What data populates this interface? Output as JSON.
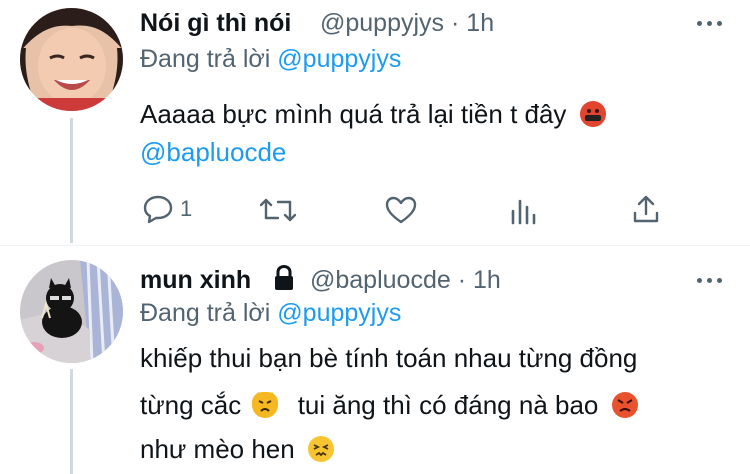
{
  "tweet1": {
    "display_name": "Nói gì thì nói",
    "handle": "@puppyjys",
    "separator": "·",
    "time": "1h",
    "replying_label": "Đang trả lời",
    "replying_to": "@puppyjys",
    "text_line1": "Aaaaa bực mình quá trả lại tiền t đây",
    "mention": "@bapluocde",
    "reply_count": "1"
  },
  "tweet2": {
    "display_name": "mun xinh",
    "handle": "@bapluocde",
    "separator": "·",
    "time": "1h",
    "replying_label": "Đang trả lời",
    "replying_to": "@puppyjys",
    "text_line1": "khiếp thui bạn bè tính toán nhau từng đồng",
    "text_line2_a": "từng cắc",
    "text_line2_b": "tui ăng thì có đáng nà bao",
    "text_line3": "như mèo hen"
  },
  "icons": {
    "more": "more-horizontal-icon",
    "reply": "reply-icon",
    "retweet": "retweet-icon",
    "like": "heart-icon",
    "views": "analytics-icon",
    "share": "share-icon",
    "lock": "lock-icon",
    "emoji_angry_cursing": "face-with-symbols-on-mouth",
    "emoji_cat_angry": "pouting-cat-face",
    "emoji_angry": "angry-face",
    "emoji_persevering": "persevering-face"
  },
  "colors": {
    "link": "#1d9bf0",
    "secondary_text": "#536471",
    "thread_line": "#cfd9de"
  }
}
